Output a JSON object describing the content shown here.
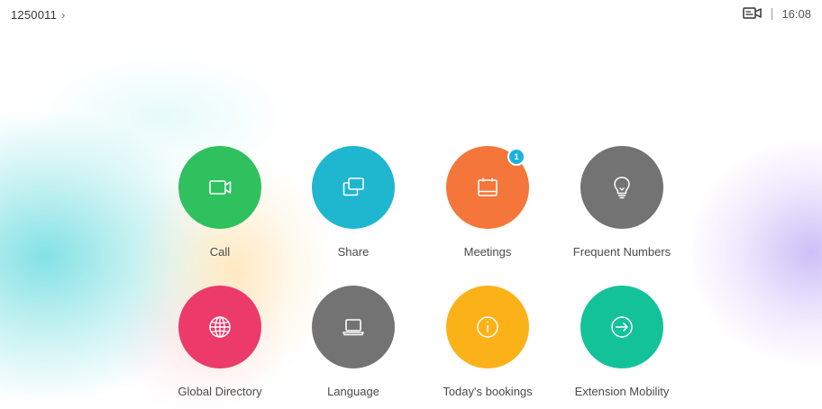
{
  "status_bar": {
    "number": "1250011",
    "chevron": "›",
    "time": "16:08",
    "camera_icon": "video-device-icon"
  },
  "tiles": [
    {
      "label": "Call",
      "icon": "video-camera-icon",
      "color": "#2fc15e"
    },
    {
      "label": "Share",
      "icon": "share-screens-icon",
      "color": "#1fb6d0"
    },
    {
      "label": "Meetings",
      "icon": "calendar-icon",
      "color": "#f5763a",
      "badge": "1"
    },
    {
      "label": "Frequent Numbers",
      "icon": "lightbulb-icon",
      "color": "#737373"
    },
    {
      "label": "Global Directory",
      "icon": "globe-icon",
      "color": "#ec3a6a"
    },
    {
      "label": "Language",
      "icon": "laptop-icon",
      "color": "#737373"
    },
    {
      "label": "Today's bookings",
      "icon": "info-icon",
      "color": "#fbb219"
    },
    {
      "label": "Extension Mobility",
      "icon": "sign-in-arrow-icon",
      "color": "#14c29a"
    }
  ]
}
